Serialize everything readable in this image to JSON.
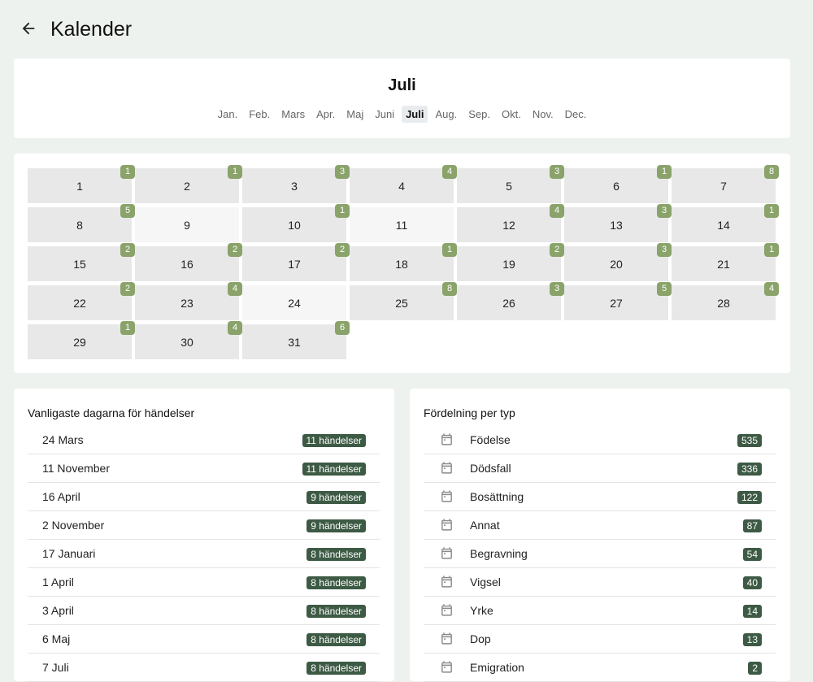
{
  "header": {
    "title": "Kalender",
    "back_icon": "arrow-left-icon"
  },
  "month_selector": {
    "current": "Juli",
    "months": [
      "Jan.",
      "Feb.",
      "Mars",
      "Apr.",
      "Maj",
      "Juni",
      "Juli",
      "Aug.",
      "Sep.",
      "Okt.",
      "Nov.",
      "Dec."
    ],
    "active_index": 6
  },
  "calendar": {
    "days": [
      {
        "day": "1",
        "count": "1"
      },
      {
        "day": "2",
        "count": "1"
      },
      {
        "day": "3",
        "count": "3"
      },
      {
        "day": "4",
        "count": "4"
      },
      {
        "day": "5",
        "count": "3"
      },
      {
        "day": "6",
        "count": "1"
      },
      {
        "day": "7",
        "count": "8"
      },
      {
        "day": "8",
        "count": "5"
      },
      {
        "day": "9",
        "count": ""
      },
      {
        "day": "10",
        "count": "1"
      },
      {
        "day": "11",
        "count": ""
      },
      {
        "day": "12",
        "count": "4"
      },
      {
        "day": "13",
        "count": "3"
      },
      {
        "day": "14",
        "count": "1"
      },
      {
        "day": "15",
        "count": "2"
      },
      {
        "day": "16",
        "count": "2"
      },
      {
        "day": "17",
        "count": "2"
      },
      {
        "day": "18",
        "count": "1"
      },
      {
        "day": "19",
        "count": "2"
      },
      {
        "day": "20",
        "count": "3"
      },
      {
        "day": "21",
        "count": "1"
      },
      {
        "day": "22",
        "count": "2"
      },
      {
        "day": "23",
        "count": "4"
      },
      {
        "day": "24",
        "count": ""
      },
      {
        "day": "25",
        "count": "8"
      },
      {
        "day": "26",
        "count": "3"
      },
      {
        "day": "27",
        "count": "5"
      },
      {
        "day": "28",
        "count": "4"
      },
      {
        "day": "29",
        "count": "1"
      },
      {
        "day": "30",
        "count": "4"
      },
      {
        "day": "31",
        "count": "6"
      }
    ],
    "badge_color": "#8aa36a"
  },
  "common_days": {
    "title": "Vanligaste dagarna för händelser",
    "items": [
      {
        "label": "24 Mars",
        "count": "11 händelser"
      },
      {
        "label": "11 November",
        "count": "11 händelser"
      },
      {
        "label": "16 April",
        "count": "9 händelser"
      },
      {
        "label": "2 November",
        "count": "9 händelser"
      },
      {
        "label": "17 Januari",
        "count": "8 händelser"
      },
      {
        "label": "1 April",
        "count": "8 händelser"
      },
      {
        "label": "3 April",
        "count": "8 händelser"
      },
      {
        "label": "6 Maj",
        "count": "8 händelser"
      },
      {
        "label": "7 Juli",
        "count": "8 händelser"
      }
    ]
  },
  "distribution": {
    "title": "Fördelning per typ",
    "icon": "calendar-icon",
    "items": [
      {
        "label": "Födelse",
        "count": "535"
      },
      {
        "label": "Dödsfall",
        "count": "336"
      },
      {
        "label": "Bosättning",
        "count": "122"
      },
      {
        "label": "Annat",
        "count": "87"
      },
      {
        "label": "Begravning",
        "count": "54"
      },
      {
        "label": "Vigsel",
        "count": "40"
      },
      {
        "label": "Yrke",
        "count": "14"
      },
      {
        "label": "Dop",
        "count": "13"
      },
      {
        "label": "Emigration",
        "count": "2"
      }
    ]
  },
  "colors": {
    "background": "#eef2ee",
    "pill": "#3d5a44",
    "badge": "#8aa36a"
  }
}
